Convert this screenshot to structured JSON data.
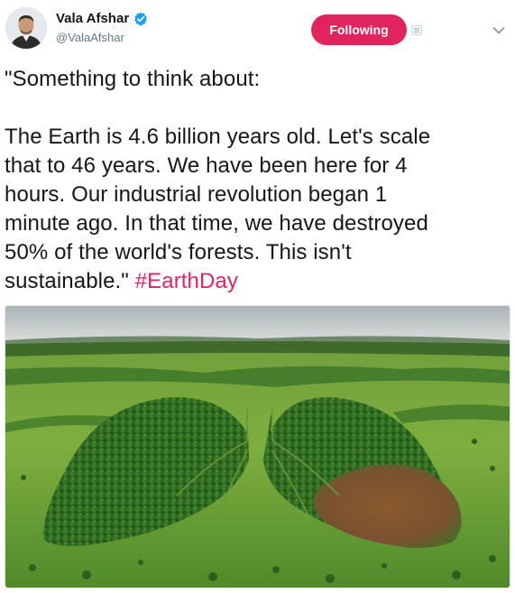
{
  "user": {
    "display_name": "Vala Afshar",
    "handle": "@ValaAfshar",
    "verified": true
  },
  "actions": {
    "follow_label": "Following",
    "follow_color": "#e0245e"
  },
  "icons": {
    "verified": "verified-badge-icon",
    "notify": "notifications-icon",
    "menu": "chevron-down-icon"
  },
  "tweet": {
    "lines": [
      "\"Something to think about:",
      "",
      "The Earth is 4.6 billion years old. Let's scale",
      "that to 46 years. We have been here for 4",
      "hours. Our industrial revolution began 1",
      "minute ago. In that time, we have destroyed",
      "50% of the world's forests. This isn't"
    ],
    "last_line_text": "sustainable.\" ",
    "hashtag": "#EarthDay"
  },
  "colors": {
    "text": "#14171a",
    "secondary_text": "#657786",
    "hashtag": "#e0245e",
    "verified": "#1da1f2"
  }
}
